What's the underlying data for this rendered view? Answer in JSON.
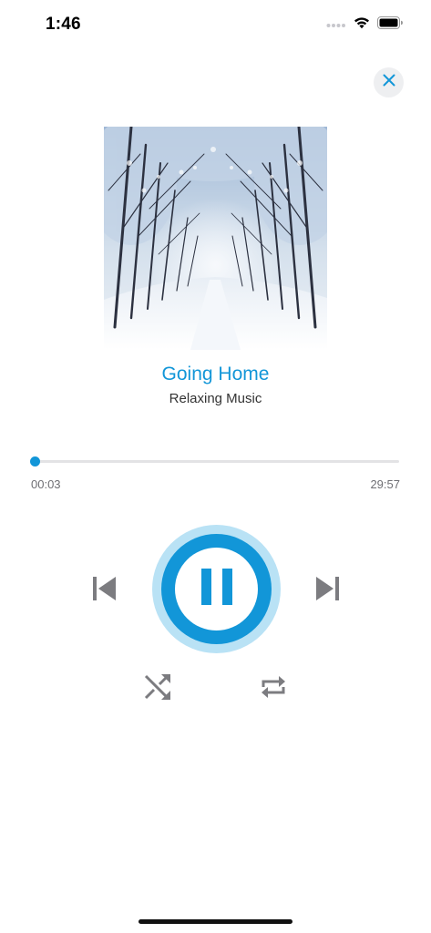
{
  "status_bar": {
    "time": "1:46",
    "icons": [
      "signal-dots-icon",
      "wifi-icon",
      "battery-icon"
    ]
  },
  "close_button": {
    "icon": "close-icon"
  },
  "album_art": {
    "description_icon": "album-artwork"
  },
  "track": {
    "title": "Going Home",
    "subtitle": "Relaxing Music"
  },
  "progress": {
    "elapsed": "00:03",
    "total": "29:57",
    "fraction": 0.0017
  },
  "controls": {
    "previous": "previous-track-icon",
    "play_pause": "pause-icon",
    "next": "next-track-icon",
    "shuffle": "shuffle-icon",
    "repeat": "repeat-icon"
  },
  "colors": {
    "accent": "#1296d8",
    "accent_light": "#b9e2f5",
    "icon_gray": "#7c7c80",
    "track_gray": "#e3e3e5"
  }
}
